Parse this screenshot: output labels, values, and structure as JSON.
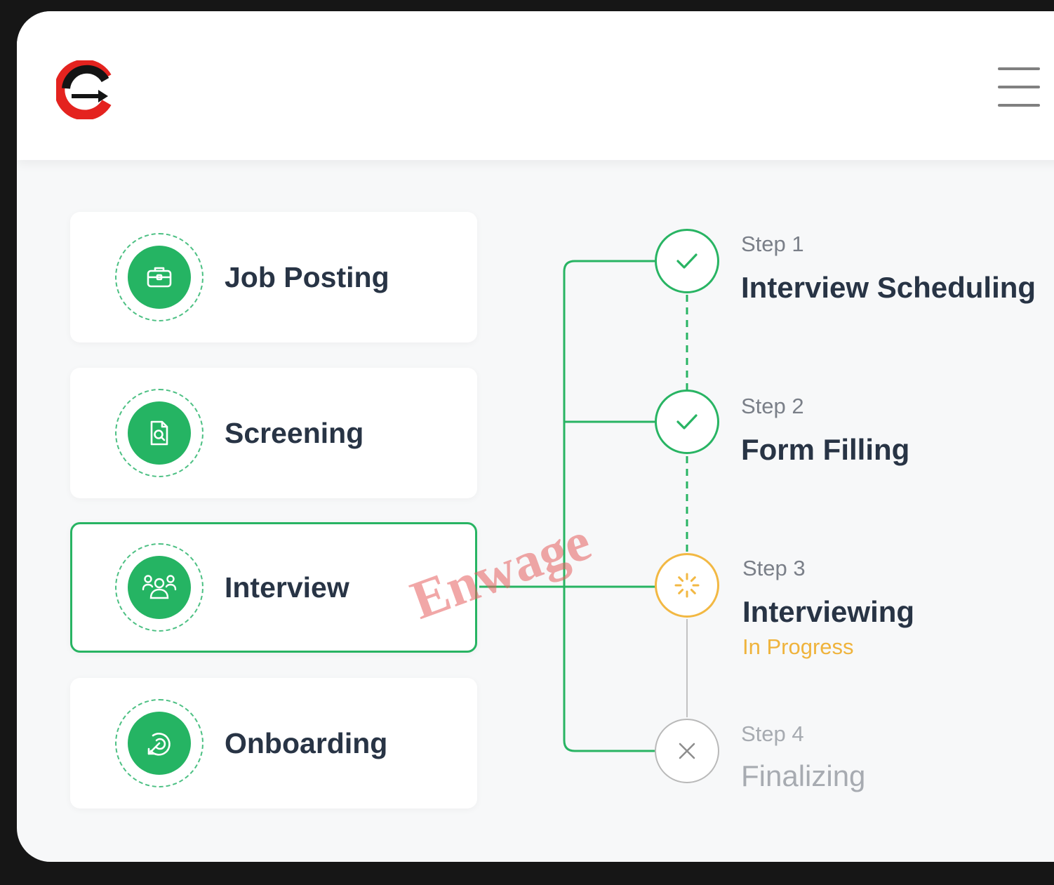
{
  "header": {
    "logo_icon": "brand-logo-icon",
    "menu_icon": "hamburger-menu-icon"
  },
  "stages": [
    {
      "label": "Job Posting",
      "icon": "briefcase-icon",
      "active": false
    },
    {
      "label": "Screening",
      "icon": "document-search-icon",
      "active": false
    },
    {
      "label": "Interview",
      "icon": "people-group-icon",
      "active": true
    },
    {
      "label": "Onboarding",
      "icon": "target-arrow-icon",
      "active": false
    }
  ],
  "steps": [
    {
      "number": "Step 1",
      "title": "Interview Scheduling",
      "state": "done",
      "icon": "check-icon"
    },
    {
      "number": "Step 2",
      "title": "Form Filling",
      "state": "done",
      "icon": "check-icon"
    },
    {
      "number": "Step 3",
      "title": "Interviewing",
      "status": "In Progress",
      "state": "in-progress",
      "icon": "loading-spinner-icon"
    },
    {
      "number": "Step 4",
      "title": "Finalizing",
      "state": "pending",
      "icon": "x-icon"
    }
  ],
  "colors": {
    "accent_green": "#28b463",
    "progress_amber": "#f2b843",
    "pending_gray": "#b9b9b9",
    "text_dark": "#283445",
    "watermark": "#e65f5f"
  },
  "watermark": "Enwage"
}
